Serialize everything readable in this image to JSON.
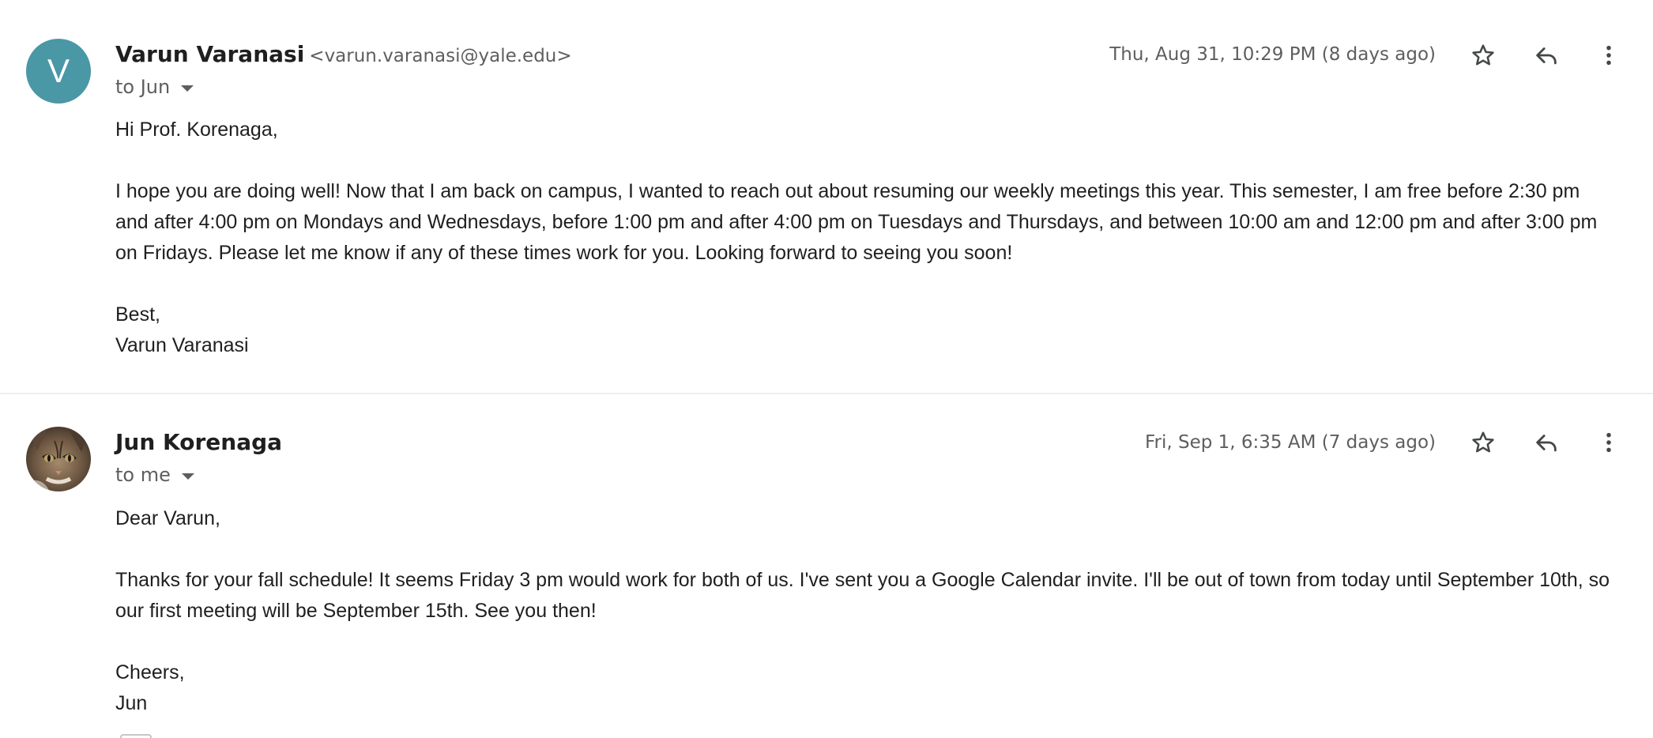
{
  "messages": [
    {
      "avatar_letter": "V",
      "avatar_color": "#4a97a6",
      "sender_name": "Varun Varanasi",
      "sender_email": "<varun.varanasi@yale.edu>",
      "recipient": "to Jun",
      "timestamp": "Thu, Aug 31, 10:29 PM (8 days ago)",
      "greeting": "Hi Prof. Korenaga,",
      "paragraph": "I hope you are doing well! Now that I am back on campus, I wanted to reach out about resuming our weekly meetings this year. This semester, I am free before 2:30 pm and after 4:00 pm on Mondays and Wednesdays, before 1:00 pm and after 4:00 pm on Tuesdays and Thursdays, and between 10:00 am and 12:00 pm and after 3:00 pm on Fridays. Please let me know if any of these times work for you. Looking forward to seeing you soon!",
      "signoff": "Best,",
      "signature": "Varun Varanasi"
    },
    {
      "avatar_icon": "cat-photo-avatar",
      "sender_name": "Jun Korenaga",
      "recipient": "to me",
      "timestamp": "Fri, Sep 1, 6:35 AM (7 days ago)",
      "greeting": "Dear Varun,",
      "paragraph": "Thanks for your fall schedule! It seems Friday 3 pm would work for both of us. I've sent you a Google Calendar invite. I'll be out of town from today until September 10th, so our first meeting will be September 15th. See you then!",
      "signoff": "Cheers,",
      "signature": "Jun"
    }
  ],
  "icons": {
    "star": "star-icon",
    "reply": "reply-icon",
    "more": "more-vert-icon",
    "recipient_caret": "caret-down-icon"
  }
}
